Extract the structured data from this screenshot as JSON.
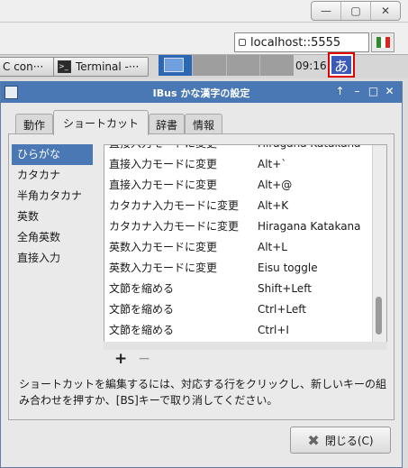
{
  "bg_window": {
    "controls": [
      "—",
      "▢",
      "✕"
    ],
    "address_value": "localhost::5555"
  },
  "taskbar": {
    "task1_label": "C con···",
    "task2_label": "Terminal -···",
    "clock": "09:16",
    "ime_indicator": "あ"
  },
  "dialog": {
    "title": "IBus かな漢字の設定",
    "tabs": [
      "動作",
      "ショートカット",
      "辞書",
      "情報"
    ],
    "active_tab": "ショートカット",
    "categories": [
      "ひらがな",
      "カタカナ",
      "半角カタカナ",
      "英数",
      "全角英数",
      "直接入力"
    ],
    "selected_category": "ひらがな",
    "shortcuts": [
      {
        "action": "直接入力モードに変更",
        "key": "Hiragana Katakana"
      },
      {
        "action": "直接入力モードに変更",
        "key": "Alt+`"
      },
      {
        "action": "直接入力モードに変更",
        "key": "Alt+@"
      },
      {
        "action": "カタカナ入力モードに変更",
        "key": "Alt+K"
      },
      {
        "action": "カタカナ入力モードに変更",
        "key": "Hiragana Katakana"
      },
      {
        "action": "英数入力モードに変更",
        "key": "Alt+L"
      },
      {
        "action": "英数入力モードに変更",
        "key": "Eisu toggle"
      },
      {
        "action": "文節を縮める",
        "key": "Shift+Left"
      },
      {
        "action": "文節を縮める",
        "key": "Ctrl+Left"
      },
      {
        "action": "文節を縮める",
        "key": "Ctrl+I"
      }
    ],
    "add_label": "+",
    "remove_label": "−",
    "help_text": "ショートカットを編集するには、対応する行をクリックし、新しいキーの組み合わせを押すか、[BS]キーで取り消してください。",
    "close_label": "閉じる(C)",
    "colors": {
      "titlebar": "#4a78b4",
      "selection": "#4a78b4",
      "ime_highlight": "#e00000"
    }
  }
}
